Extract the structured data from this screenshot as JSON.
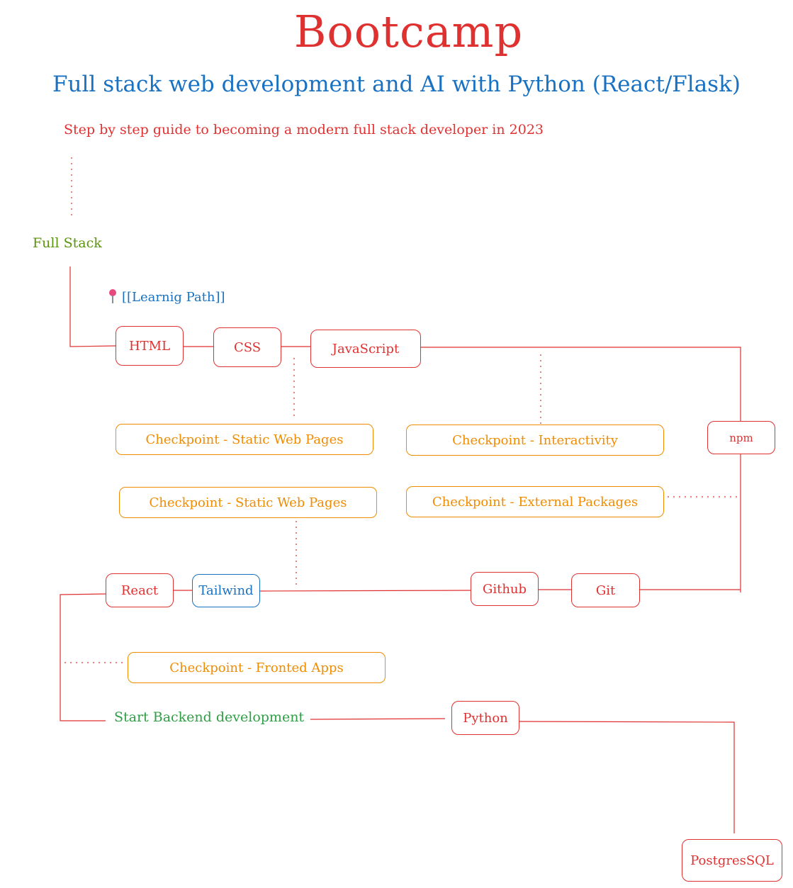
{
  "title": "Bootcamp",
  "subtitle": "Full stack web development and AI with Python (React/Flask)",
  "guide": "Step by step guide to becoming a modern full stack developer in 2023",
  "start_label": "Full Stack",
  "learning_path": "[[Learnig Path]]",
  "nodes": {
    "html": "HTML",
    "css": "CSS",
    "javascript": "JavaScript",
    "npm": "npm",
    "react": "React",
    "tailwind": "Tailwind",
    "github": "Github",
    "git": "Git",
    "python": "Python",
    "postgres": "PostgresSQL"
  },
  "checkpoints": {
    "static1": "Checkpoint - Static Web Pages",
    "interactivity": "Checkpoint - Interactivity",
    "static2": "Checkpoint - Static Web Pages",
    "external": "Checkpoint - External Packages",
    "frontend": "Checkpoint - Fronted Apps"
  },
  "backend_label": "Start Backend development",
  "colors": {
    "red": "#e03131",
    "blue": "#1971c2",
    "orange": "#f08c00",
    "green": "#2f9e44",
    "olive": "#5c940d"
  }
}
